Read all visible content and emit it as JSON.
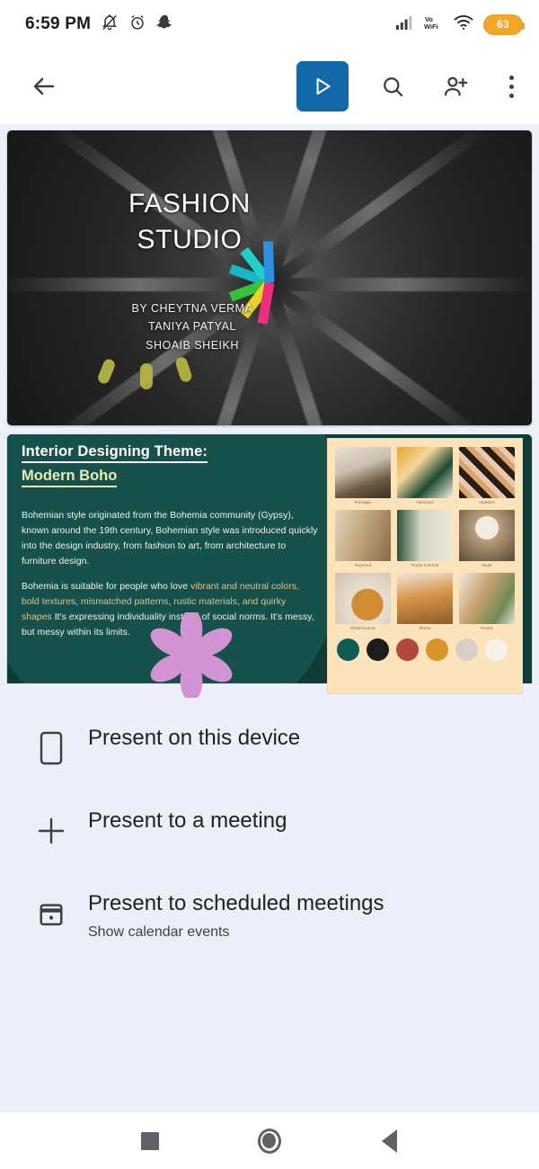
{
  "status_bar": {
    "time": "6:59 PM",
    "battery_percent": "63",
    "icons": [
      "bell-off-icon",
      "alarm-clock-icon",
      "snapchat-icon",
      "signal-bars-icon",
      "vowifi-icon",
      "wifi-icon",
      "battery-badge"
    ],
    "vowifi_label_top": "Vo",
    "vowifi_label_bottom": "WiFi"
  },
  "toolbar": {
    "back_label": "Back",
    "present_label": "Present",
    "search_label": "Search",
    "add_person_label": "Add people",
    "more_label": "More options"
  },
  "deck": {
    "slide1": {
      "title": "FASHION\nSTUDIO",
      "title_line1": "FASHION",
      "title_line2": "STUDIO",
      "byline": "BY  CHEYTNA VERMA\nTANIYA PATYAL\nSHOAIB SHEIKH",
      "authors": [
        "BY  CHEYTNA VERMA",
        "TANIYA PATYAL",
        "SHOAIB SHEIKH"
      ],
      "background": "colored pencil tips radial photo"
    },
    "slide2": {
      "heading_line1": "Interior Designing Theme:",
      "heading_line2": "Modern Boho",
      "paragraph1": "Bohemian style originated from the Bohemia community (Gypsy), known around the 19th century, Bohemian style was introduced quickly into the design industry, from fashion to art, from architecture to furniture design.",
      "paragraph2_part1": "Bohemia is suitable for people who love ",
      "paragraph2_highlight": "vibrant and neutral colors, bold textures, mismatched patterns, rustic materials, and quirky shapes",
      "paragraph2_part2": "  It's expressing individuality instead of social norms. It's messy, but messy within its limits.",
      "moodboard": {
        "labels": [
          "#vintage",
          "#abstract",
          "#pattern",
          "#layered",
          "#cozy-minimal",
          "#wall",
          "#bold-texture",
          "#boho",
          "#rustic"
        ],
        "swatches": [
          "#0f5c55",
          "#1c1c1c",
          "#b1483c",
          "#d99528",
          "#d8cec6",
          "#f7f3eb"
        ]
      },
      "bg_color": "#0d3b38"
    }
  },
  "bottom_sheet": {
    "items": [
      {
        "icon": "phone-icon",
        "title": "Present on this device",
        "subtitle": ""
      },
      {
        "icon": "plus-icon",
        "title": "Present to a meeting",
        "subtitle": ""
      },
      {
        "icon": "calendar-icon",
        "title": "Present to scheduled meetings",
        "subtitle": "Show calendar events"
      }
    ]
  },
  "nav_bar": {
    "recents_label": "Recents",
    "home_label": "Home",
    "back_label": "Back"
  }
}
